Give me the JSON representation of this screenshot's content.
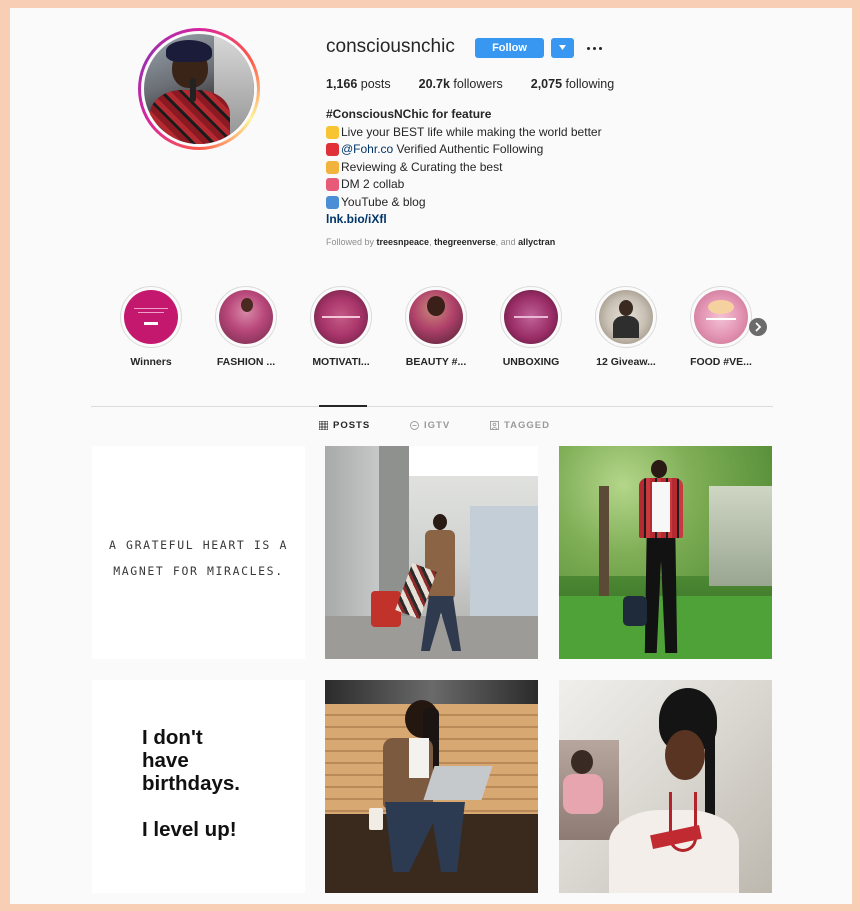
{
  "profile": {
    "username": "consciousnchic",
    "follow_label": "Follow",
    "stats": {
      "posts_count": "1,166",
      "posts_label": "posts",
      "followers_count": "20.7k",
      "followers_label": "followers",
      "following_count": "2,075",
      "following_label": "following"
    },
    "bio": {
      "name": "#ConsciousNChic for feature",
      "line1": "Live your BEST life while making the world better",
      "line2_mention": "@Fohr.co",
      "line2_rest": " Verified Authentic Following",
      "line3": "Reviewing & Curating the best",
      "line4": "DM 2 collab",
      "line5": "YouTube & blog",
      "link": "lnk.bio/iXfl"
    },
    "followed_by": {
      "prefix": "Followed by ",
      "user1": "treesnpeace",
      "sep": ", ",
      "user2": "thegreenverse",
      "and": ", and ",
      "user3": "allyctran"
    }
  },
  "highlights": [
    {
      "label": "Winners",
      "color": "#c4186f"
    },
    {
      "label": "FASHION ...",
      "color": "#b8477a"
    },
    {
      "label": "MOTIVATI...",
      "color": "#a8356a"
    },
    {
      "label": "BEAUTY #...",
      "color": "#b0416a"
    },
    {
      "label": "UNBOXING",
      "color": "#9a2d66"
    },
    {
      "label": "12 Giveaw...",
      "color": "#c9c1b5"
    },
    {
      "label": "FOOD #VE...",
      "color": "#e496b4"
    }
  ],
  "tabs": {
    "posts": "POSTS",
    "igtv": "IGTV",
    "tagged": "TAGGED"
  },
  "posts": {
    "quote1_line1": "A GRATEFUL HEART IS A",
    "quote1_line2": "MAGNET FOR MIRACLES.",
    "quote2_line1": "I don't",
    "quote2_line2": "have",
    "quote2_line3": "birthdays.",
    "quote2_line4": "I level up!"
  },
  "colors": {
    "accent": "#3897f0",
    "background_frame": "#f8cfb4",
    "panel": "#fafafa",
    "link": "#003569"
  }
}
